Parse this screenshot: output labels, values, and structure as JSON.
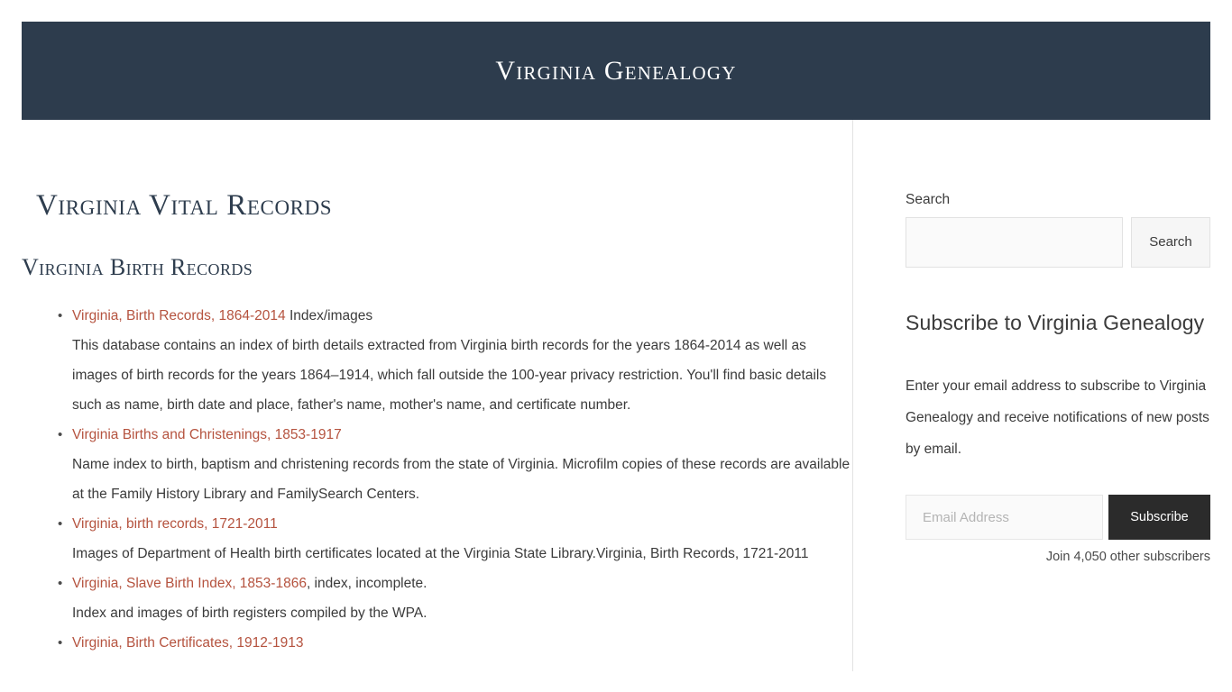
{
  "site": {
    "title": "Virginia Genealogy",
    "header_bg": "#2d3c4d",
    "link_color": "#b5533f",
    "heading_color": "#2e3d4e"
  },
  "main": {
    "page_title": "Virginia Vital Records",
    "section_title": "Virginia Birth Records",
    "records": [
      {
        "link": "Virginia, Birth Records, 1864-2014",
        "suffix": " Index/images",
        "description": "This database contains an index of birth details extracted from Virginia birth records for the years 1864-2014 as well as images of birth records for the years 1864–1914, which fall outside the 100-year privacy restriction. You'll find basic details such as name, birth date and place, father's name, mother's name, and certificate number."
      },
      {
        "link": "Virginia Births and Christenings, 1853-1917",
        "suffix": "",
        "description": "Name index to birth, baptism and christening records from the state of Virginia. Microfilm copies of these records are available at the Family History Library and FamilySearch Centers."
      },
      {
        "link": "Virginia, birth records, 1721-2011",
        "suffix": "",
        "description": "Images of Department of Health birth certificates located at the Virginia State Library.Virginia, Birth Records, 1721-2011"
      },
      {
        "link": "Virginia, Slave Birth Index, 1853-1866",
        "suffix": ", index, incomplete.",
        "description": "Index and images of birth registers compiled by the WPA."
      },
      {
        "link": "Virginia, Birth Certificates, 1912-1913",
        "suffix": "",
        "description": ""
      }
    ]
  },
  "sidebar": {
    "search": {
      "label": "Search",
      "value": "",
      "placeholder": "",
      "button_label": "Search"
    },
    "subscribe": {
      "title": "Subscribe to Virginia Genealogy",
      "description": "Enter your email address to subscribe to Virginia Genealogy and receive notifications of new posts by email.",
      "email_value": "",
      "email_placeholder": "Email Address",
      "button_label": "Subscribe",
      "subscriber_count": "Join 4,050 other subscribers"
    }
  }
}
